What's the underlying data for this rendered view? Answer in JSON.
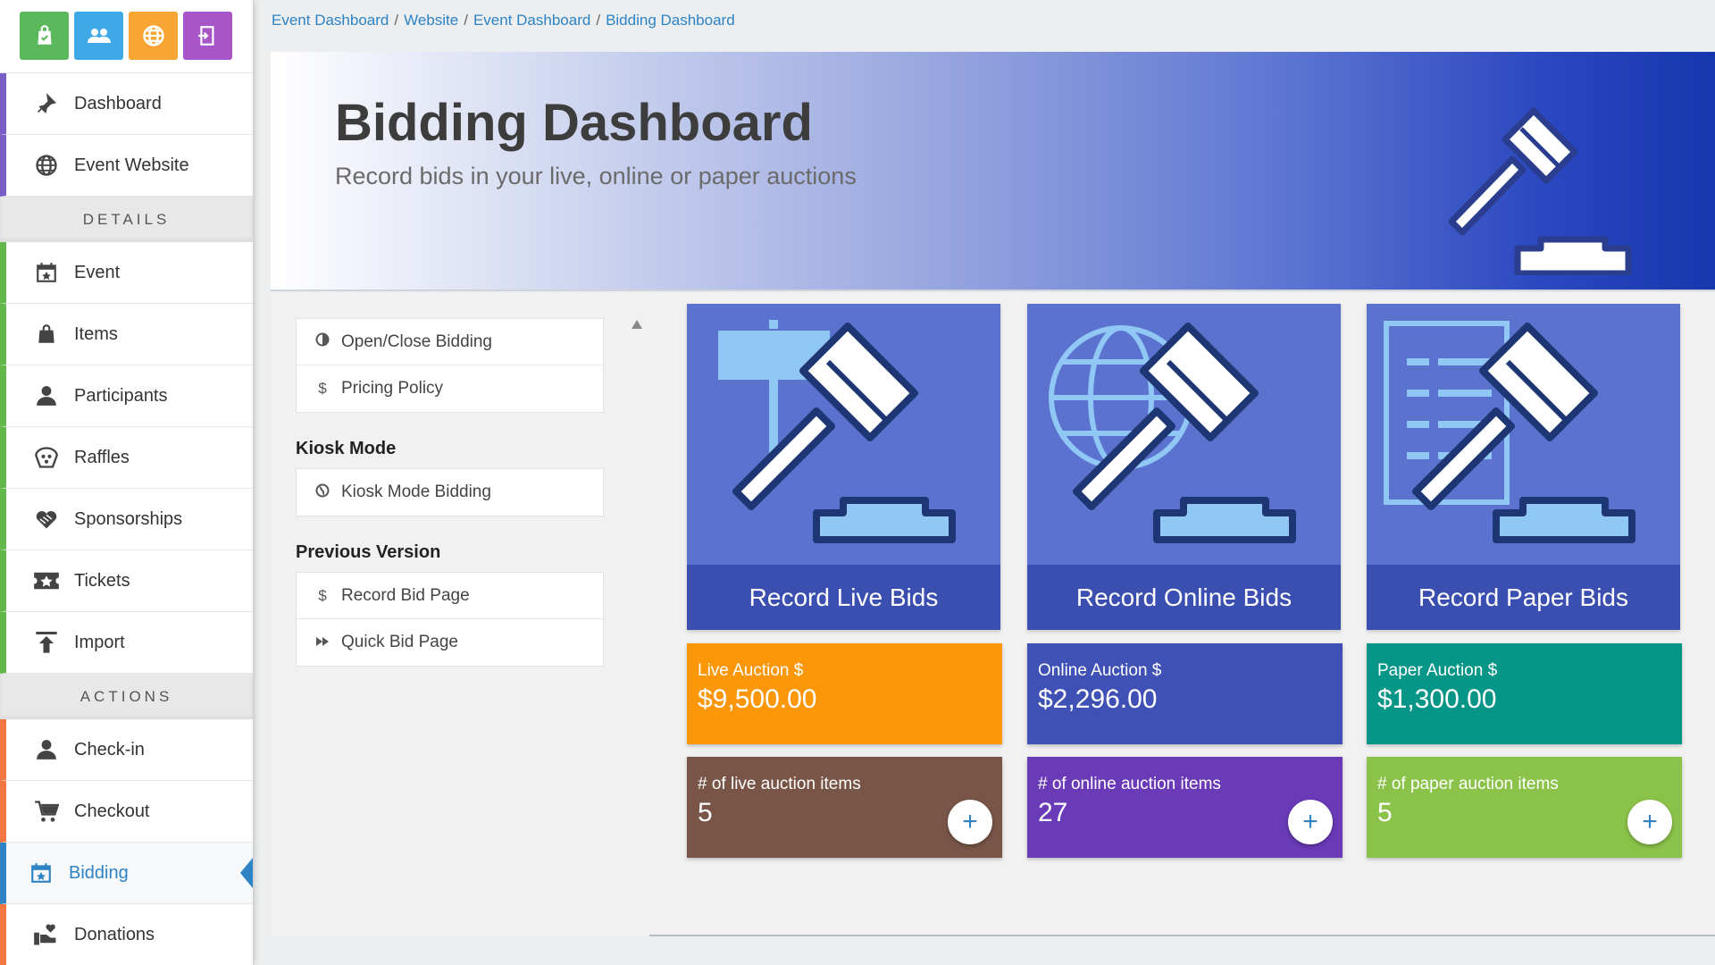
{
  "sidebar": {
    "top_icons": [
      {
        "name": "shopping-bag-icon",
        "color": "#5cb85c"
      },
      {
        "name": "users-icon",
        "color": "#3fa9e8"
      },
      {
        "name": "globe-icon",
        "color": "#f9a533"
      },
      {
        "name": "exit-icon",
        "color": "#a855c8"
      }
    ],
    "items_main": [
      {
        "label": "Dashboard",
        "icon": "dashboard-icon"
      },
      {
        "label": "Event Website",
        "icon": "globe-icon"
      }
    ],
    "section_details": "DETAILS",
    "items_details": [
      {
        "label": "Event",
        "icon": "calendar-star-icon"
      },
      {
        "label": "Items",
        "icon": "shopping-bag-icon"
      },
      {
        "label": "Participants",
        "icon": "person-icon"
      },
      {
        "label": "Raffles",
        "icon": "raffle-icon"
      },
      {
        "label": "Sponsorships",
        "icon": "handshake-heart-icon"
      },
      {
        "label": "Tickets",
        "icon": "ticket-star-icon"
      },
      {
        "label": "Import",
        "icon": "upload-icon"
      }
    ],
    "section_actions": "ACTIONS",
    "items_actions": [
      {
        "label": "Check-in",
        "icon": "person-icon"
      },
      {
        "label": "Checkout",
        "icon": "cart-icon"
      },
      {
        "label": "Bidding",
        "icon": "calendar-star-icon",
        "active": true
      },
      {
        "label": "Donations",
        "icon": "donation-hand-icon"
      }
    ]
  },
  "breadcrumb": [
    "Event Dashboard",
    "Website",
    "Event Dashboard",
    "Bidding Dashboard"
  ],
  "hero": {
    "title": "Bidding Dashboard",
    "subtitle": "Record bids in your live, online or paper auctions"
  },
  "left_menu": {
    "group1": [
      {
        "label": "Open/Close Bidding",
        "icon": "half-circle-icon"
      },
      {
        "label": "Pricing Policy",
        "icon": "$"
      }
    ],
    "kiosk_title": "Kiosk Mode",
    "group2": [
      {
        "label": "Kiosk Mode Bidding",
        "icon": "globe-icon"
      }
    ],
    "prev_title": "Previous Version",
    "group3": [
      {
        "label": "Record Bid Page",
        "icon": "$"
      },
      {
        "label": "Quick Bid Page",
        "icon": "fast-forward-icon"
      }
    ]
  },
  "cards": [
    {
      "title": "Record Live Bids"
    },
    {
      "title": "Record Online Bids"
    },
    {
      "title": "Record Paper Bids"
    }
  ],
  "totals": [
    {
      "label": "Live Auction $",
      "value": "$9,500.00",
      "color": "#fb9708"
    },
    {
      "label": "Online Auction $",
      "value": "$2,296.00",
      "color": "#3f51b5"
    },
    {
      "label": "Paper Auction $",
      "value": "$1,300.00",
      "color": "#069688"
    }
  ],
  "counts": [
    {
      "label": "# of live auction items",
      "value": "5",
      "color": "#795548"
    },
    {
      "label": "# of online auction items",
      "value": "27",
      "color": "#6a3ab7"
    },
    {
      "label": "# of paper auction items",
      "value": "5",
      "color": "#8bc34a"
    }
  ],
  "plus_symbol": "+"
}
